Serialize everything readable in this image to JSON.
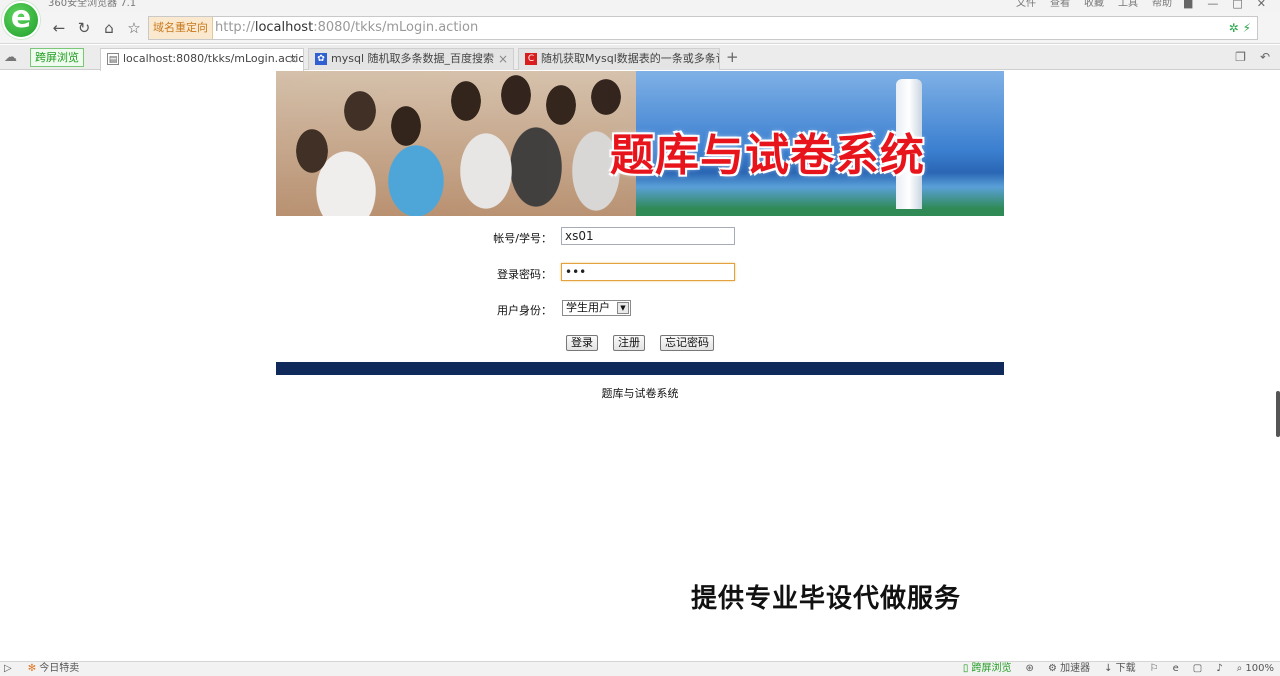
{
  "browser": {
    "app_title": "360安全浏览器 7.1",
    "menus": [
      "文件",
      "查看",
      "收藏",
      "工具",
      "帮助"
    ],
    "redirect_tag": "域名重定向",
    "url_prefix": "http://",
    "url_host": "localhost",
    "url_rest": ":8080/tkks/mLogin.action",
    "split_view_label": "跨屏浏览",
    "tabs": [
      {
        "title": "localhost:8080/tkks/mLogin.action",
        "active": true
      },
      {
        "title": "mysql 随机取多条数据_百度搜索",
        "active": false
      },
      {
        "title": "随机获取Mysql数据表的一条或多条记",
        "active": false
      }
    ],
    "new_tab_symbol": "+"
  },
  "page": {
    "banner_title": "题库与试卷系统",
    "form": {
      "account_label": "帐号/学号：",
      "account_value": "xs01",
      "password_label": "登录密码：",
      "password_value": "•••",
      "role_label": "用户身份：",
      "role_value": "学生用户"
    },
    "buttons": {
      "login": "登录",
      "register": "注册",
      "forgot": "忘记密码"
    },
    "footer_text": "题库与试卷系统",
    "watermark": "提供专业毕设代做服务"
  },
  "statusbar": {
    "today_label": "今日特卖",
    "split_view_label": "跨屏浏览",
    "accelerator_label": "加速器",
    "download_label": "下载",
    "zoom": "100%"
  },
  "colors": {
    "banner_title": "#e8141c",
    "footer_bar": "#0f2a5a",
    "focus_border": "#e3a23d",
    "brand_green": "#1e9e2a"
  }
}
